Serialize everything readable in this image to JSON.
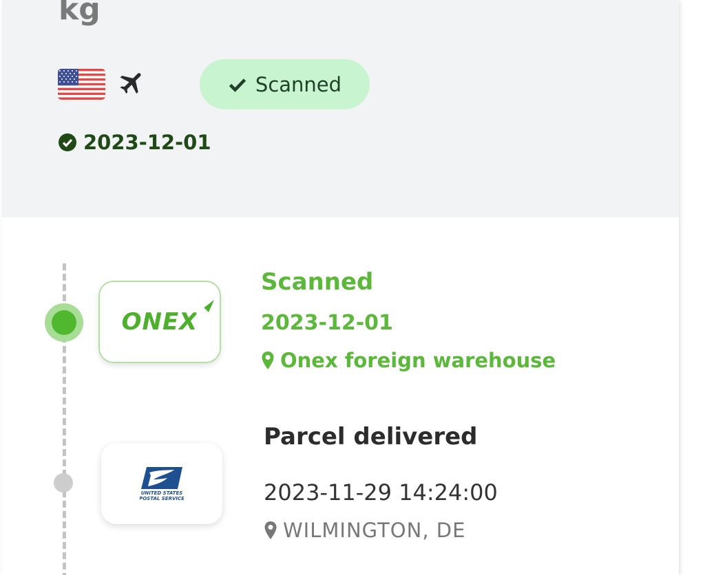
{
  "summary": {
    "weight_unit": "kg",
    "country_flag_icon": "us-flag-icon",
    "transport_icon": "airplane-icon",
    "status_badge": "Scanned",
    "status_date": "2023-12-01"
  },
  "colors": {
    "accent_green": "#5cb83a",
    "badge_bg": "#c8f5cf",
    "dark_green": "#1f4a16",
    "inactive_gray": "#cdcdcd"
  },
  "events": [
    {
      "carrier_logo": "ONEX",
      "title": "Scanned",
      "date": "2023-12-01",
      "location": "Onex foreign warehouse",
      "active": true
    },
    {
      "carrier_logo": "UNITED STATES POSTAL SERVICE",
      "title": "Parcel delivered",
      "date": "2023-11-29 14:24:00",
      "location": "WILMINGTON, DE",
      "active": false
    }
  ]
}
